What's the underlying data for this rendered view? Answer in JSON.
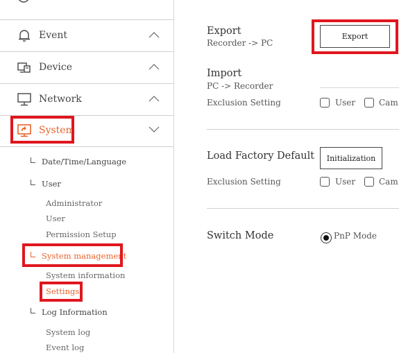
{
  "sidebar": {
    "menus": [
      {
        "label": "Event",
        "icon": "bell-icon"
      },
      {
        "label": "Device",
        "icon": "device-icon"
      },
      {
        "label": "Network",
        "icon": "monitor-icon"
      },
      {
        "label": "System",
        "icon": "system-icon"
      }
    ],
    "system_items": {
      "date_time_language": "Date/Time/Language",
      "user": "User",
      "administrator": "Administrator",
      "user_sub": "User",
      "permission_setup": "Permission Setup",
      "system_management": "System management",
      "system_information": "System information",
      "settings": "Settings",
      "log_information": "Log Information",
      "system_log": "System log",
      "event_log": "Event log"
    }
  },
  "main": {
    "export": {
      "title": "Export",
      "subtitle": "Recorder -> PC",
      "button": "Export"
    },
    "import": {
      "title": "Import",
      "subtitle": "PC -> Recorder",
      "exclusion_label": "Exclusion Setting",
      "options": [
        "User",
        "Cam"
      ]
    },
    "factory": {
      "title": "Load Factory Default",
      "button": "Initialization",
      "exclusion_label": "Exclusion Setting",
      "options": [
        "User",
        "Cam"
      ]
    },
    "switch_mode": {
      "title": "Switch Mode",
      "option": "PnP Mode",
      "selected": true
    }
  },
  "colors": {
    "active": "#e8642c",
    "highlight": "#e0161e"
  }
}
